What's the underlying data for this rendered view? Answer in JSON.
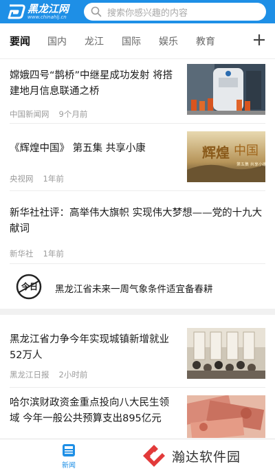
{
  "app": {
    "logo_text": "黑龙江网",
    "logo_url": "www.chinahlj.cn",
    "brand_color": "#1e8fe6"
  },
  "search": {
    "placeholder": "搜索你感兴趣的内容",
    "icon": "search-icon"
  },
  "tabs": [
    {
      "label": "要闻",
      "active": true
    },
    {
      "label": "国内",
      "active": false
    },
    {
      "label": "龙江",
      "active": false
    },
    {
      "label": "国际",
      "active": false
    },
    {
      "label": "娱乐",
      "active": false
    },
    {
      "label": "教育",
      "active": false
    }
  ],
  "tabs_add_icon": "plus-icon",
  "feed": {
    "items": [
      {
        "title": "嫦娥四号“鹊桥”中继星成功发射 将搭建地月信息联通之桥",
        "source": "中国新闻网",
        "time": "9个月前"
      },
      {
        "title": "《辉煌中国》 第五集 共享小康",
        "source": "央视网",
        "time": "1年前"
      },
      {
        "title": "新华社社评：高举伟大旗帜 实现伟大梦想——党的十九大献词",
        "source": "新华社",
        "time": "1年前"
      },
      {
        "title": "黑龙江省力争今年实现城镇新增就业52万人",
        "source": "黑龙江日报",
        "time": "2小时前"
      },
      {
        "title": "哈尔滨财政资金重点投向八大民生领域 今年一般公共预算支出895亿元",
        "source": "",
        "time": ""
      }
    ],
    "weather": {
      "logo_text": "今日天气",
      "text": "黑龙江省未来一周气象条件适宜备春耕"
    }
  },
  "bottom_nav": {
    "news_label": "新闻",
    "news_icon": "news-icon"
  },
  "watermark": {
    "text": "瀚达软件园"
  }
}
